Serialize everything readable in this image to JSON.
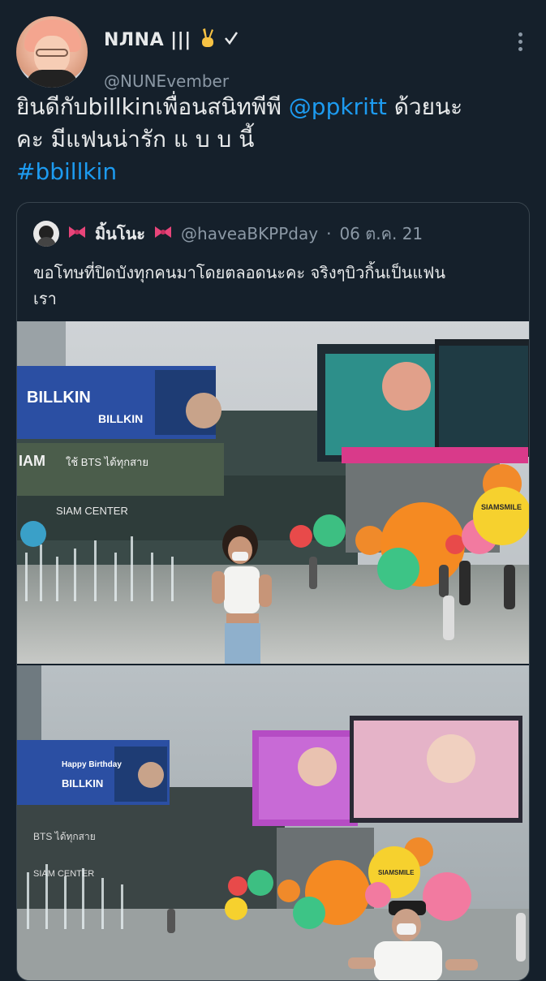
{
  "tweet": {
    "display_name": "NЛNA",
    "name_decor": "|||",
    "handle": "@NUNEvember",
    "text_line1_a": "ยินดีกับbillkinเพื่อนสนิทพีพี ",
    "mention": "@ppkritt",
    "text_line1_b": " ด้วยนะ",
    "text_line2": "คะ มีแฟนน่ารัก แ บ บ นี้",
    "hashtag": "#bbillkin"
  },
  "quote": {
    "name": "มิ้นโนะ",
    "handle": "@haveaBKPPday",
    "separator": "·",
    "date": "06 ต.ค. 21",
    "text_line1": "ขอโทษที่ปิดบังทุกคนมาโดยตลอดนะคะ จริงๆบิวกิ้นเป็นแฟน",
    "text_line2": "เรา"
  },
  "photo1": {
    "billboard_text_1": "BILLKIN",
    "billboard_text_2": "BILLKIN",
    "screen_text": "ใช้ BTS ได้ทุกสาย",
    "mall_sign": "SIAM CENTER",
    "partial_sign": "IAM",
    "balloon_text": "SIAMSMILE"
  },
  "photo2": {
    "billboard_text_1": "Happy Birthday",
    "billboard_text_2": "BILLKIN",
    "screen_text": "BTS ได้ทุกสาย",
    "mall_sign": "SIAM CENTER",
    "balloon_text": "SIAMSMILE"
  },
  "colors": {
    "background": "#15202b",
    "text": "#e7e9ea",
    "secondary": "#8b98a5",
    "link": "#1d9bf0",
    "border": "#38444d",
    "bow": "#e8457a"
  },
  "icons": {
    "victory": "victory-hand-icon",
    "verified": "checkmark-icon",
    "more": "more-vertical-icon",
    "bow": "ribbon-bow-icon"
  }
}
